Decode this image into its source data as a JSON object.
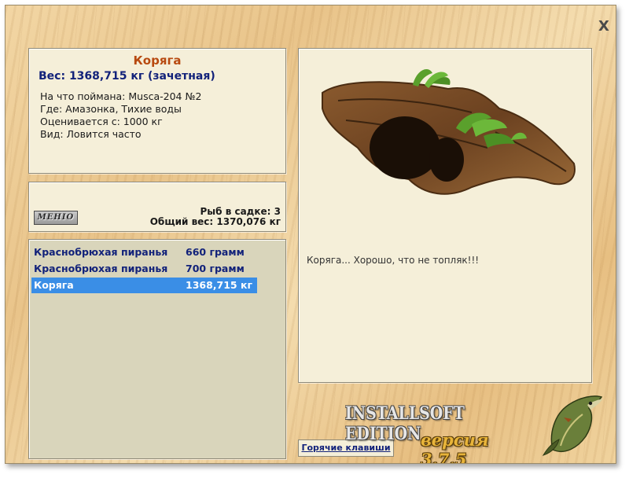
{
  "window": {
    "close_label": "X"
  },
  "fish_info": {
    "title": "Коряга",
    "weight": "Вес: 1368,715 кг (зачетная)",
    "lines": [
      "На что поймана: Musca-204 №2",
      "Где: Амазонка, Тихие воды",
      "Оценивается с: 1000 кг",
      "Вид: Ловится часто"
    ]
  },
  "keepnet": {
    "menu_label": "MEHIO",
    "fish_count": "Рыб в садке: 3",
    "total_weight": "Общий вес: 1370,076 кг"
  },
  "catch_list": [
    {
      "name": "Краснобрюхая пиранья",
      "weight": "660 грамм",
      "selected": false
    },
    {
      "name": "Краснобрюхая пиранья",
      "weight": "700 грамм",
      "selected": false
    },
    {
      "name": "Коряга",
      "weight": "1368,715 кг",
      "selected": true
    }
  ],
  "preview": {
    "image_icon": "driftwood-image",
    "description": "Коряга... Хорошо, что не топляк!!!"
  },
  "footer": {
    "hotkeys_label": "Горячие клавиши",
    "edition": "INSTALLSOFT EDITION",
    "version": "версия 3.7.5",
    "logo_icon": "pike-fish-icon"
  },
  "colors": {
    "accent_title": "#b84a10",
    "text_blue": "#12227a",
    "selection": "#3a8ee6",
    "panel_bg": "#f5efd9",
    "list_bg": "#d9d5bb"
  }
}
